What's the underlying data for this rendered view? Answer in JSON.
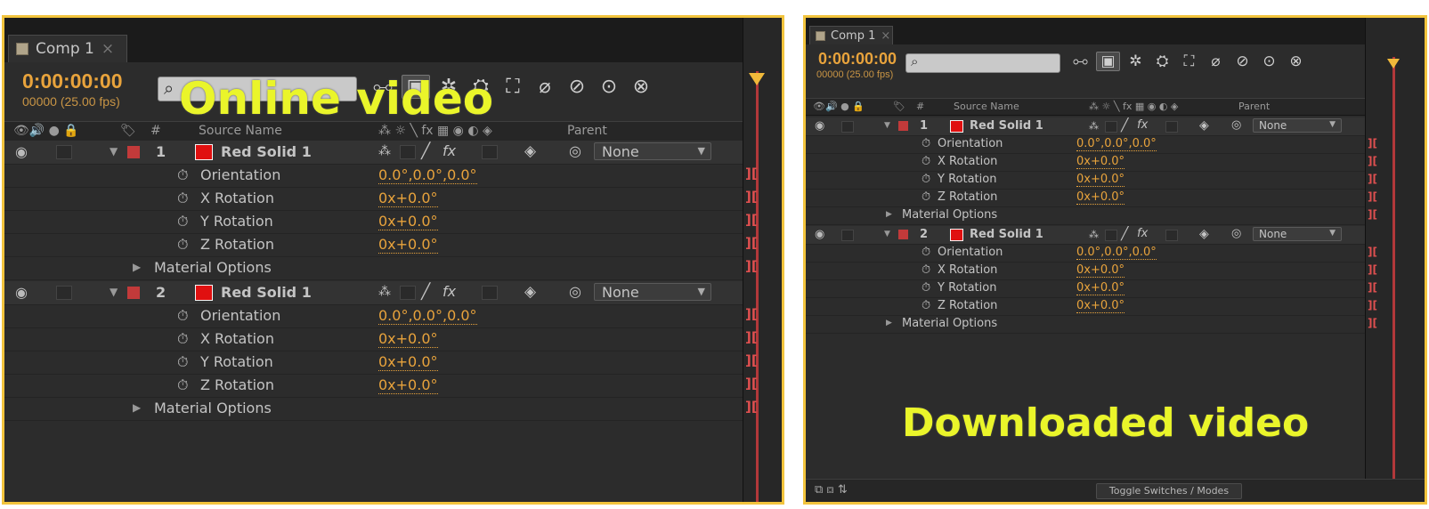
{
  "left": {
    "overlay_label": "Online video",
    "tab": {
      "title": "Comp 1",
      "close": "×"
    },
    "timecode": "0:00:00:00",
    "frames_fps": "00000 (25.00 fps)",
    "search_icon": "⌕",
    "columns": {
      "switches": "👁🔊 ● 🔒",
      "label": "🏷",
      "number": "#",
      "source_name": "Source Name",
      "layer_switches": "⁂ ☼ ╲ fx ▦ ◉ ◐ ◈",
      "parent": "Parent"
    },
    "layers": [
      {
        "number": "1",
        "name": "Red Solid 1",
        "parent": "None",
        "props": [
          {
            "name": "Orientation",
            "value": "0.0°,0.0°,0.0°"
          },
          {
            "name": "X Rotation",
            "value": "0x+0.0°"
          },
          {
            "name": "Y Rotation",
            "value": "0x+0.0°"
          },
          {
            "name": "Z Rotation",
            "value": "0x+0.0°"
          }
        ],
        "group": "Material Options"
      },
      {
        "number": "2",
        "name": "Red Solid 1",
        "parent": "None",
        "props": [
          {
            "name": "Orientation",
            "value": "0.0°,0.0°,0.0°"
          },
          {
            "name": "X Rotation",
            "value": "0x+0.0°"
          },
          {
            "name": "Y Rotation",
            "value": "0x+0.0°"
          },
          {
            "name": "Z Rotation",
            "value": "0x+0.0°"
          }
        ],
        "group": "Material Options"
      }
    ]
  },
  "right": {
    "overlay_label": "Downloaded video",
    "tab": {
      "title": "Comp 1",
      "close": "×"
    },
    "timecode": "0:00:00:00",
    "frames_fps": "00000 (25.00 fps)",
    "search_icon": "⌕",
    "columns": {
      "switches": "👁🔊 ● 🔒",
      "label": "🏷",
      "number": "#",
      "source_name": "Source Name",
      "layer_switches": "⁂ ☼ ╲ fx ▦ ◉ ◐ ◈",
      "parent": "Parent"
    },
    "layers": [
      {
        "number": "1",
        "name": "Red Solid 1",
        "parent": "None",
        "props": [
          {
            "name": "Orientation",
            "value": "0.0°,0.0°,0.0°"
          },
          {
            "name": "X Rotation",
            "value": "0x+0.0°"
          },
          {
            "name": "Y Rotation",
            "value": "0x+0.0°"
          },
          {
            "name": "Z Rotation",
            "value": "0x+0.0°"
          }
        ],
        "group": "Material Options"
      },
      {
        "number": "2",
        "name": "Red Solid 1",
        "parent": "None",
        "props": [
          {
            "name": "Orientation",
            "value": "0.0°,0.0°,0.0°"
          },
          {
            "name": "X Rotation",
            "value": "0x+0.0°"
          },
          {
            "name": "Y Rotation",
            "value": "0x+0.0°"
          },
          {
            "name": "Z Rotation",
            "value": "0x+0.0°"
          }
        ],
        "group": "Material Options"
      }
    ],
    "footer": {
      "toggle": "Toggle Switches / Modes"
    }
  },
  "icons": {
    "eye": "◉",
    "stopwatch": "⏱",
    "expand_down": "▼",
    "expand_right": "▶",
    "shy": "⁂",
    "pen": "╱",
    "fx": "fx",
    "cube": "◈",
    "spiral": "◎",
    "dropdown": "▼",
    "ibar": "][",
    "tools": [
      "⧟",
      "▣",
      "✲",
      "⛭",
      "⛶",
      "⌀",
      "⊘",
      "⊙",
      "⊗"
    ]
  },
  "colors": {
    "frame": "#f2c43d",
    "overlay": "#eaf52a",
    "timecode": "#e8a33c",
    "solid": "#e01010"
  }
}
